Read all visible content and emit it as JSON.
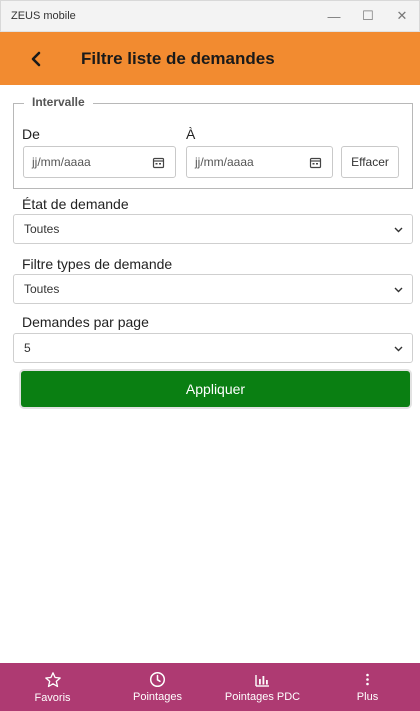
{
  "window": {
    "title": "ZEUS mobile",
    "minimize": "—",
    "maximize": "☐",
    "close": "✕"
  },
  "header": {
    "title": "Filtre liste de demandes"
  },
  "interval": {
    "legend": "Intervalle",
    "from_label": "De",
    "to_label": "À",
    "from_placeholder": "jj/mm/aaaa",
    "to_placeholder": "jj/mm/aaaa",
    "clear_label": "Effacer"
  },
  "state": {
    "label": "État de demande",
    "value": "Toutes"
  },
  "types": {
    "label": "Filtre types de demande",
    "value": "Toutes"
  },
  "per_page": {
    "label": "Demandes par page",
    "value": "5"
  },
  "apply_label": "Appliquer",
  "nav": [
    {
      "label": "Favoris",
      "icon": "star-icon"
    },
    {
      "label": "Pointages",
      "icon": "clock-icon"
    },
    {
      "label": "Pointages PDC",
      "icon": "bar-chart-icon"
    },
    {
      "label": "Plus",
      "icon": "more-vertical-icon"
    }
  ],
  "colors": {
    "header": "#f28b30",
    "apply": "#0a7f12",
    "nav": "#ae3a72"
  }
}
